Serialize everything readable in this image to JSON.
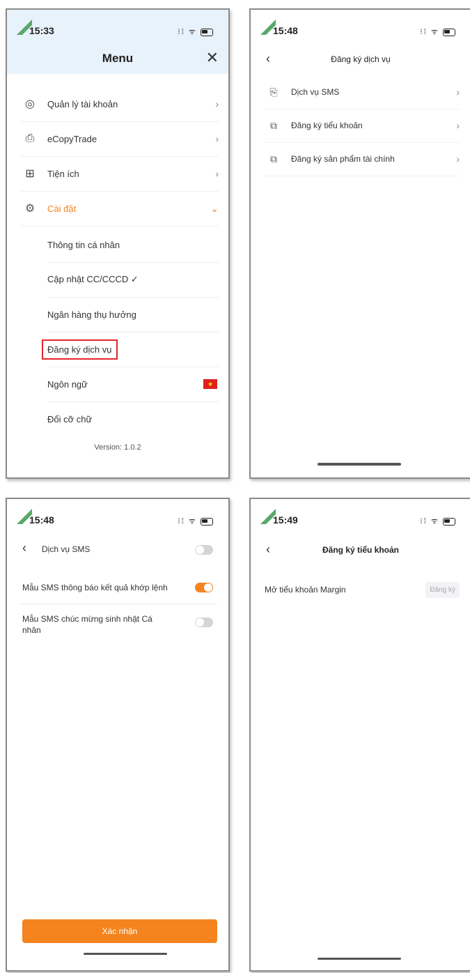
{
  "phone1": {
    "time": "15:33",
    "title": "Menu",
    "items": [
      {
        "label": "Quản lý tài khoản",
        "icon": "account-icon"
      },
      {
        "label": "eCopyTrade",
        "icon": "copy-icon"
      },
      {
        "label": "Tiện ích",
        "icon": "grid-icon"
      },
      {
        "label": "Cài đặt",
        "icon": "settings-icon"
      }
    ],
    "sub_items": [
      "Thông tin cá nhân",
      "Cập nhật CC/CCCD ✓",
      "Ngân hàng thụ hưởng",
      "Đăng ký dịch vụ",
      "Ngôn ngữ",
      "Đổi cỡ chữ"
    ],
    "version": "Version: 1.0.2"
  },
  "phone2": {
    "time": "15:48",
    "title": "Đăng ký dịch vụ",
    "items": [
      {
        "label": "Dịch vụ SMS"
      },
      {
        "label": "Đăng ký tiểu khoản"
      },
      {
        "label": "Đăng ký sản phẩm tài chính"
      }
    ]
  },
  "phone3": {
    "time": "15:48",
    "title": "Dịch vụ SMS",
    "rows": [
      {
        "label": "Mẫu SMS thông báo kết quả khớp lệnh",
        "on": true
      },
      {
        "label": "Mẫu SMS chúc mừng sinh nhật Cá nhân",
        "on": false
      }
    ],
    "confirm": "Xác nhận"
  },
  "phone4": {
    "time": "15:49",
    "title": "Đăng ký tiểu khoản",
    "row_label": "Mở tiểu khoản Margin",
    "row_button": "Đăng ký"
  },
  "colors": {
    "accent": "#f5841f",
    "highlight_box": "#e0252d",
    "header_bg": "#e8f2fb"
  }
}
